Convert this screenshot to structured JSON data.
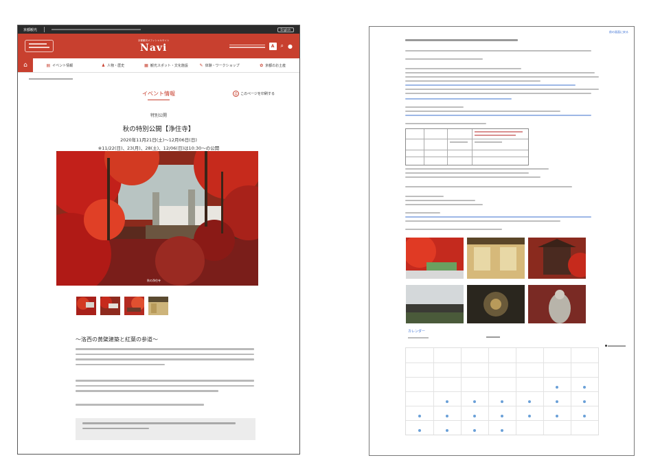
{
  "left_page": {
    "site": {
      "logo_sub": "京都観光オフィシャルサイト",
      "logo_main": "Navi",
      "topbar_label": "京都観光",
      "topbar_right": "English"
    },
    "nav": {
      "items": [
        {
          "label": "イベント情報",
          "icon": "calendar-icon"
        },
        {
          "label": "人物・歴史",
          "icon": "person-icon"
        },
        {
          "label": "観光スポット・文化施設",
          "icon": "grid-icon"
        },
        {
          "label": "体験・ワークショップ",
          "icon": "pencil-icon"
        },
        {
          "label": "京都のお土産",
          "icon": "gift-icon"
        }
      ]
    },
    "event": {
      "section_title": "イベント情報",
      "print_label": "このページを印刷する",
      "category": "特別公開",
      "name": "秋の特別公開【浄住寺】",
      "date_line1": "2020年11月21日(土)〜12月06日(日)",
      "date_line2": "※11/22(日)、23(月)、28(土)、12/06(日)は10:30〜の公開",
      "photo_caption": "秋の浄住寺",
      "subheading": "〜洛西の黄檗建築と紅葉の参道〜"
    }
  },
  "right_page": {
    "top_link": "前の画面に戻る",
    "calendar_title": "カレンダー",
    "palette": {
      "accent_red": "#c8402f",
      "link_blue": "#3a6fd3",
      "dot_blue": "#6aa0d8"
    }
  }
}
